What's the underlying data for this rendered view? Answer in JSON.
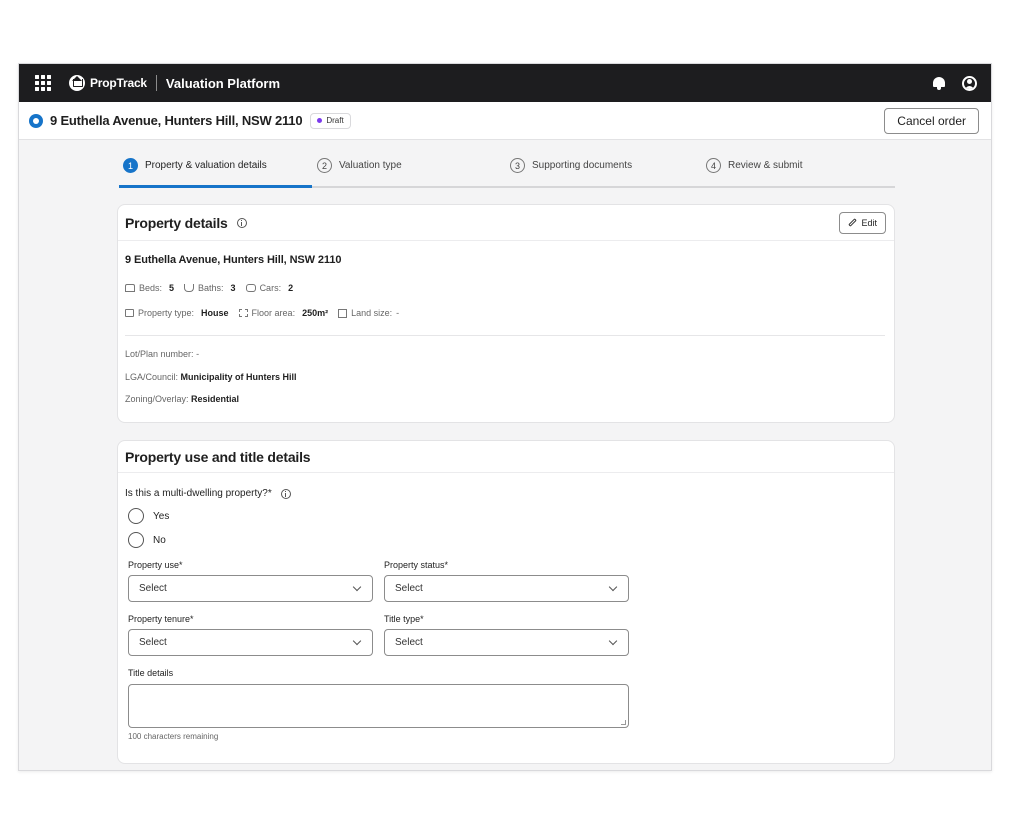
{
  "topbar": {
    "brand": "PropTrack",
    "app_title": "Valuation Platform"
  },
  "header": {
    "address": "9 Euthella Avenue, Hunters Hill, NSW 2110",
    "status_badge": "Draft",
    "cancel_label": "Cancel order"
  },
  "stepper": {
    "steps": [
      {
        "num": "1",
        "label": "Property & valuation details",
        "active": true
      },
      {
        "num": "2",
        "label": "Valuation type",
        "active": false
      },
      {
        "num": "3",
        "label": "Supporting documents",
        "active": false
      },
      {
        "num": "4",
        "label": "Review & submit",
        "active": false
      }
    ]
  },
  "property_details": {
    "title": "Property details",
    "edit_label": "Edit",
    "address": "9 Euthella Avenue, Hunters Hill, NSW 2110",
    "beds_label": "Beds:",
    "beds_value": "5",
    "baths_label": "Baths:",
    "baths_value": "3",
    "cars_label": "Cars:",
    "cars_value": "2",
    "type_label": "Property type:",
    "type_value": "House",
    "floor_label": "Floor area:",
    "floor_value": "250m²",
    "land_label": "Land size:",
    "land_value": "-",
    "lot_label": "Lot/Plan number:",
    "lot_value": "-",
    "lga_label": "LGA/Council:",
    "lga_value": "Municipality of Hunters Hill",
    "zoning_label": "Zoning/Overlay:",
    "zoning_value": "Residential"
  },
  "use_title": {
    "title": "Property use and title details",
    "question": "Is this a multi-dwelling property?*",
    "options": [
      "Yes",
      "No"
    ],
    "property_use_label": "Property use*",
    "property_status_label": "Property status*",
    "property_tenure_label": "Property tenure*",
    "title_type_label": "Title type*",
    "select_placeholder": "Select",
    "title_details_label": "Title details",
    "remaining": "100 characters remaining"
  },
  "colors": {
    "accent": "#1674c9",
    "topbar": "#1d1d1f",
    "draft_dot": "#7c3aed"
  }
}
